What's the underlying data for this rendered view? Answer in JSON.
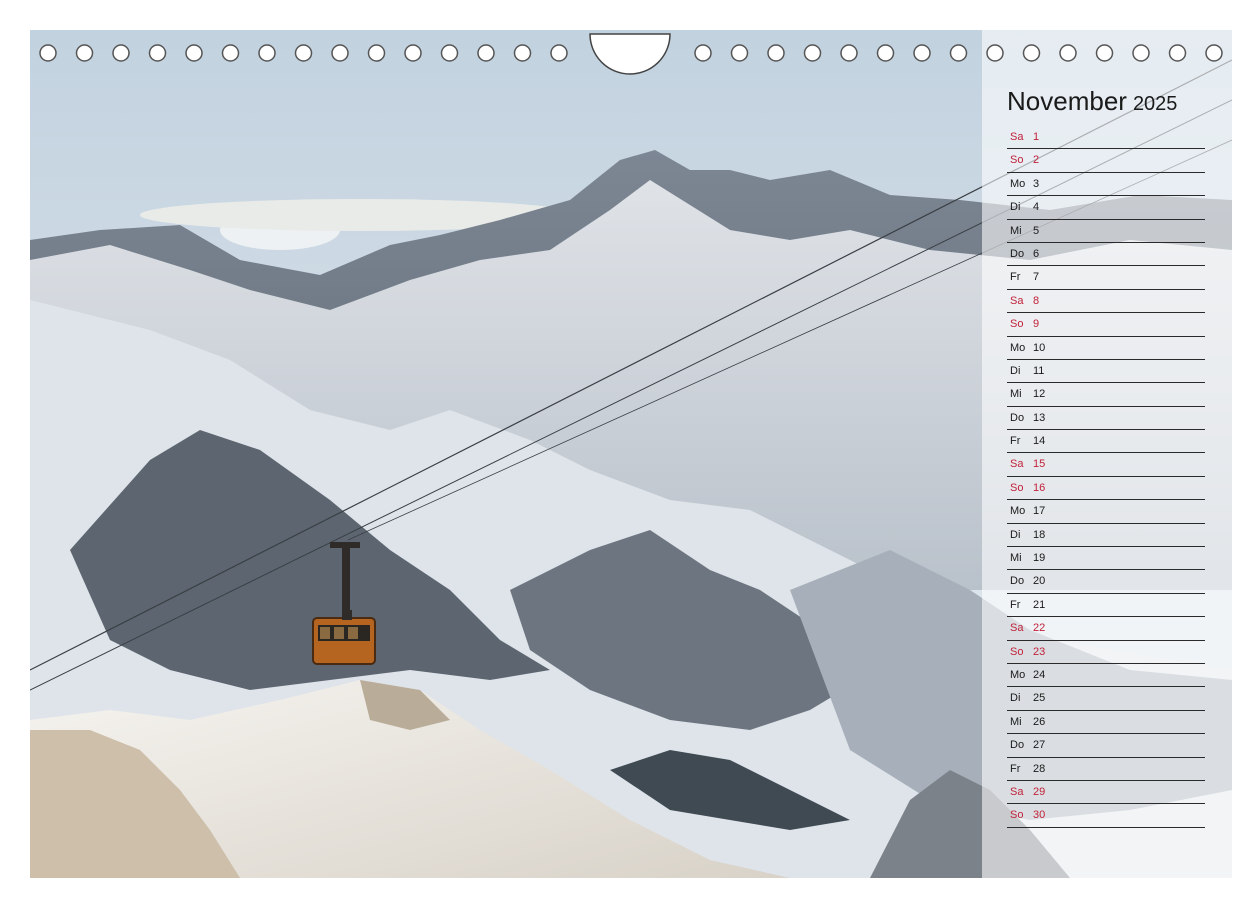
{
  "calendar": {
    "month": "November",
    "year": "2025",
    "days": [
      {
        "wd": "Sa",
        "d": "1",
        "weekend": true
      },
      {
        "wd": "So",
        "d": "2",
        "weekend": true
      },
      {
        "wd": "Mo",
        "d": "3",
        "weekend": false
      },
      {
        "wd": "Di",
        "d": "4",
        "weekend": false
      },
      {
        "wd": "Mi",
        "d": "5",
        "weekend": false
      },
      {
        "wd": "Do",
        "d": "6",
        "weekend": false
      },
      {
        "wd": "Fr",
        "d": "7",
        "weekend": false
      },
      {
        "wd": "Sa",
        "d": "8",
        "weekend": true
      },
      {
        "wd": "So",
        "d": "9",
        "weekend": true
      },
      {
        "wd": "Mo",
        "d": "10",
        "weekend": false
      },
      {
        "wd": "Di",
        "d": "11",
        "weekend": false
      },
      {
        "wd": "Mi",
        "d": "12",
        "weekend": false
      },
      {
        "wd": "Do",
        "d": "13",
        "weekend": false
      },
      {
        "wd": "Fr",
        "d": "14",
        "weekend": false
      },
      {
        "wd": "Sa",
        "d": "15",
        "weekend": true
      },
      {
        "wd": "So",
        "d": "16",
        "weekend": true
      },
      {
        "wd": "Mo",
        "d": "17",
        "weekend": false
      },
      {
        "wd": "Di",
        "d": "18",
        "weekend": false
      },
      {
        "wd": "Mi",
        "d": "19",
        "weekend": false
      },
      {
        "wd": "Do",
        "d": "20",
        "weekend": false
      },
      {
        "wd": "Fr",
        "d": "21",
        "weekend": false
      },
      {
        "wd": "Sa",
        "d": "22",
        "weekend": true
      },
      {
        "wd": "So",
        "d": "23",
        "weekend": true
      },
      {
        "wd": "Mo",
        "d": "24",
        "weekend": false
      },
      {
        "wd": "Di",
        "d": "25",
        "weekend": false
      },
      {
        "wd": "Mi",
        "d": "26",
        "weekend": false
      },
      {
        "wd": "Do",
        "d": "27",
        "weekend": false
      },
      {
        "wd": "Fr",
        "d": "28",
        "weekend": false
      },
      {
        "wd": "Sa",
        "d": "29",
        "weekend": true
      },
      {
        "wd": "So",
        "d": "30",
        "weekend": true
      }
    ]
  },
  "colors": {
    "weekend_text": "#c2213a",
    "weekday_text": "#1a1a1a"
  },
  "photo": {
    "subject": "snowy-alps-cable-car"
  }
}
